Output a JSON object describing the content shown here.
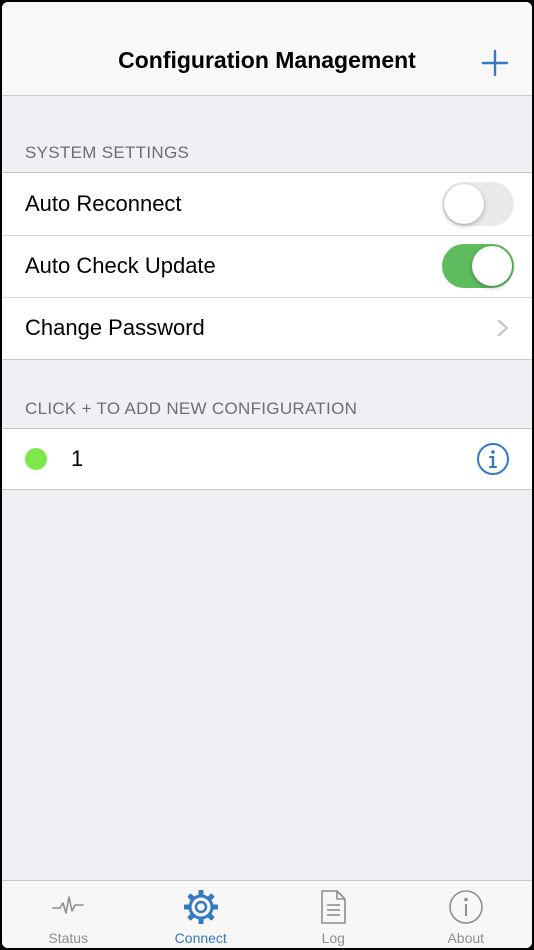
{
  "navbar": {
    "title": "Configuration Management",
    "add_icon": "plus-icon"
  },
  "system_settings": {
    "header": "SYSTEM SETTINGS",
    "items": [
      {
        "label": "Auto Reconnect",
        "type": "toggle",
        "value": false
      },
      {
        "label": "Auto Check Update",
        "type": "toggle",
        "value": true
      },
      {
        "label": "Change Password",
        "type": "disclosure",
        "icon": "chevron-right-icon"
      }
    ]
  },
  "configurations": {
    "header": "CLICK + TO ADD NEW CONFIGURATION",
    "items": [
      {
        "name": "1",
        "status_color": "#7ce84a",
        "icon": "info-icon"
      }
    ]
  },
  "tabbar": {
    "tabs": [
      {
        "label": "Status",
        "icon": "pulse-icon",
        "active": false
      },
      {
        "label": "Connect",
        "icon": "gear-icon",
        "active": true
      },
      {
        "label": "Log",
        "icon": "document-icon",
        "active": false
      },
      {
        "label": "About",
        "icon": "info-icon",
        "active": false
      }
    ]
  },
  "colors": {
    "accent": "#3478c6",
    "toggle_on": "#5ebb5e",
    "status_connected": "#7ce84a",
    "background": "#efeff4"
  }
}
